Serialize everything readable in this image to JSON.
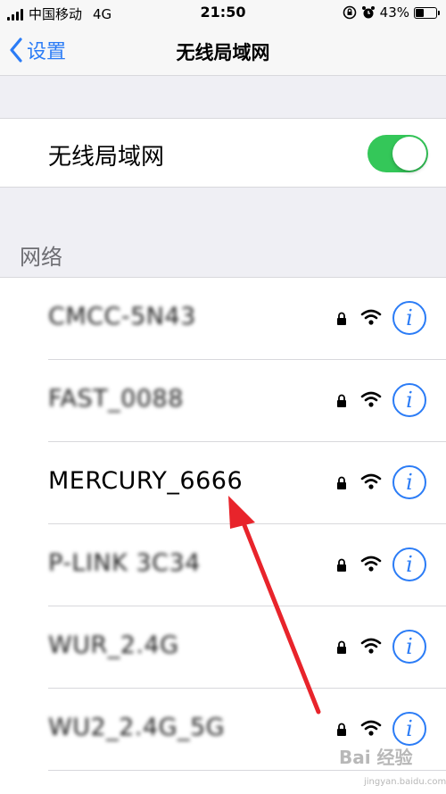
{
  "status_bar": {
    "carrier": "中国移动",
    "network": "4G",
    "time": "21:50",
    "battery": "43%",
    "battery_level": 0.43
  },
  "nav": {
    "back_label": "设置",
    "title": "无线局域网"
  },
  "wifi_toggle": {
    "label": "无线局域网",
    "on": true,
    "on_color": "#34c759"
  },
  "networks_section": {
    "header": "网络",
    "items": [
      {
        "name": "CMCC-5N43",
        "obscured": true,
        "secured": true
      },
      {
        "name": "FAST_0088",
        "obscured": true,
        "secured": true
      },
      {
        "name": "MERCURY_6666",
        "obscured": false,
        "secured": true
      },
      {
        "name": "P-LINK 3C34",
        "obscured": true,
        "secured": true
      },
      {
        "name": "WUR_2.4G",
        "obscured": true,
        "secured": true
      },
      {
        "name": "WU2_2.4G_5G",
        "obscured": true,
        "secured": true
      }
    ]
  },
  "colors": {
    "accent": "#2b7cf6",
    "annotation_arrow": "#e8242b"
  },
  "watermark": {
    "text": "Bai 经验",
    "sub": "jingyan.baidu.com"
  }
}
